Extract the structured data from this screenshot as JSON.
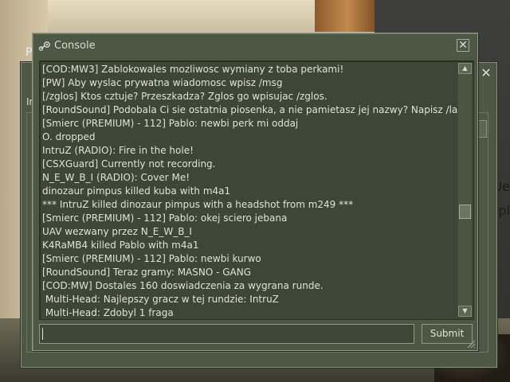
{
  "window": {
    "title": "Console",
    "close_glyph": "✕",
    "app_icon": "steam-icon"
  },
  "background_dialog": {
    "label": "In",
    "close_glyph": "✕"
  },
  "background_text": {
    "top_left": "P",
    "right_top": "Ue",
    "right_bottom": "cpl"
  },
  "log": {
    "lines": [
      "[COD:MW3] Zablokowales mozliwosc wymiany z toba perkami!",
      "[PW] Aby wyslac prywatna wiadomosc wpisz /msg",
      "[/zglos] Ktos cztuje? Przeszkadza? Zglos go wpisujac /zglos.",
      "[RoundSound] Podobala Ci sie ostatnia piosenka, a nie pamietasz jej nazwy? Napisz /last",
      "[Smierc (PREMIUM) - 112] Pablo: newbi perk mi oddaj",
      "O. dropped",
      "IntruZ (RADIO): Fire in the hole!",
      "[CSXGuard] Currently not recording.",
      "N_E_W_B_I (RADIO): Cover Me!",
      "dinozaur pimpus killed kuba with m4a1",
      "*** IntruZ killed dinozaur pimpus with a headshot from m249 ***",
      "[Smierc (PREMIUM) - 112] Pablo: okej sciero jebana",
      "UAV wezwany przez N_E_W_B_I",
      "K4RaMB4 killed Pablo with m4a1",
      "[Smierc (PREMIUM) - 112] Pablo: newbi kurwo",
      "[RoundSound] Teraz gramy: MASNO - GANG",
      "[COD:MW] Dostales 160 doswiadczenia za wygrana runde.",
      " Multi-Head: Najlepszy gracz w tej rundzie: IntruZ",
      " Multi-Head: Zdobyl 1 fraga"
    ],
    "scroll_position_fraction": 0.6
  },
  "scrollbar": {
    "up_glyph": "▲",
    "down_glyph": "▼"
  },
  "input": {
    "value": "",
    "placeholder": ""
  },
  "submit": {
    "label": "Submit"
  },
  "colors": {
    "panel": "#4c5844",
    "log_bg": "#3e4637",
    "text": "#dfe3d4",
    "border": "#8e9885"
  }
}
